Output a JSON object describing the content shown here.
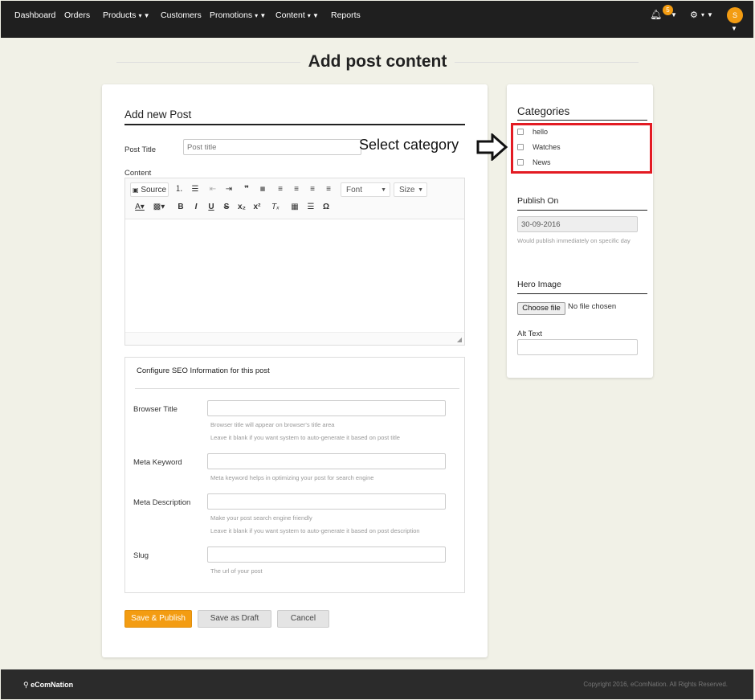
{
  "nav": {
    "items": [
      {
        "label": "Dashboard"
      },
      {
        "label": "Orders"
      },
      {
        "label": "Products"
      },
      {
        "label": "Customers"
      },
      {
        "label": "Promotions"
      },
      {
        "label": "Content"
      },
      {
        "label": "Reports"
      }
    ],
    "notification_count": "5",
    "avatar_initial": "S"
  },
  "page": {
    "title": "Add post content"
  },
  "post": {
    "section_title": "Add new Post",
    "title_label": "Post Title",
    "title_placeholder": "Post title",
    "content_label": "Content",
    "toolbar": {
      "source": "Source",
      "font": "Font",
      "size": "Size"
    }
  },
  "seo": {
    "title": "Configure SEO Information for this post",
    "browser_title_label": "Browser Title",
    "browser_title_help1": "Browser title will appear on browser's title area",
    "browser_title_help2": "Leave it blank if you want system to auto-generate it based on post title",
    "meta_keyword_label": "Meta Keyword",
    "meta_keyword_help": "Meta keyword helps in optimizing your post for search engine",
    "meta_description_label": "Meta Description",
    "meta_description_help1": "Make your post search engine friendly",
    "meta_description_help2": "Leave it blank if you want system to auto-generate it based on post description",
    "slug_label": "Slug",
    "slug_help": "The url of your post"
  },
  "buttons": {
    "save_publish": "Save & Publish",
    "save_draft": "Save as Draft",
    "cancel": "Cancel"
  },
  "sidebar": {
    "categories_title": "Categories",
    "categories": [
      {
        "label": "hello"
      },
      {
        "label": "Watches"
      },
      {
        "label": "News"
      }
    ],
    "publish_on_title": "Publish On",
    "publish_on_value": "30-09-2016",
    "publish_on_help": "Would publish immediately on specific day",
    "hero_image_title": "Hero Image",
    "choose_file_label": "Choose file",
    "no_file_text": "No file chosen",
    "alt_text_label": "Alt Text"
  },
  "annotation": {
    "text": "Select category"
  },
  "footer": {
    "logo_text": "eComNation",
    "copyright": "Copyright 2016, eComNation. All Rights Reserved."
  },
  "colors": {
    "accent": "#f39c12",
    "annotation_red": "#e31b23",
    "nav_bg": "#1f1f1f",
    "page_bg": "#f1f1e7"
  }
}
